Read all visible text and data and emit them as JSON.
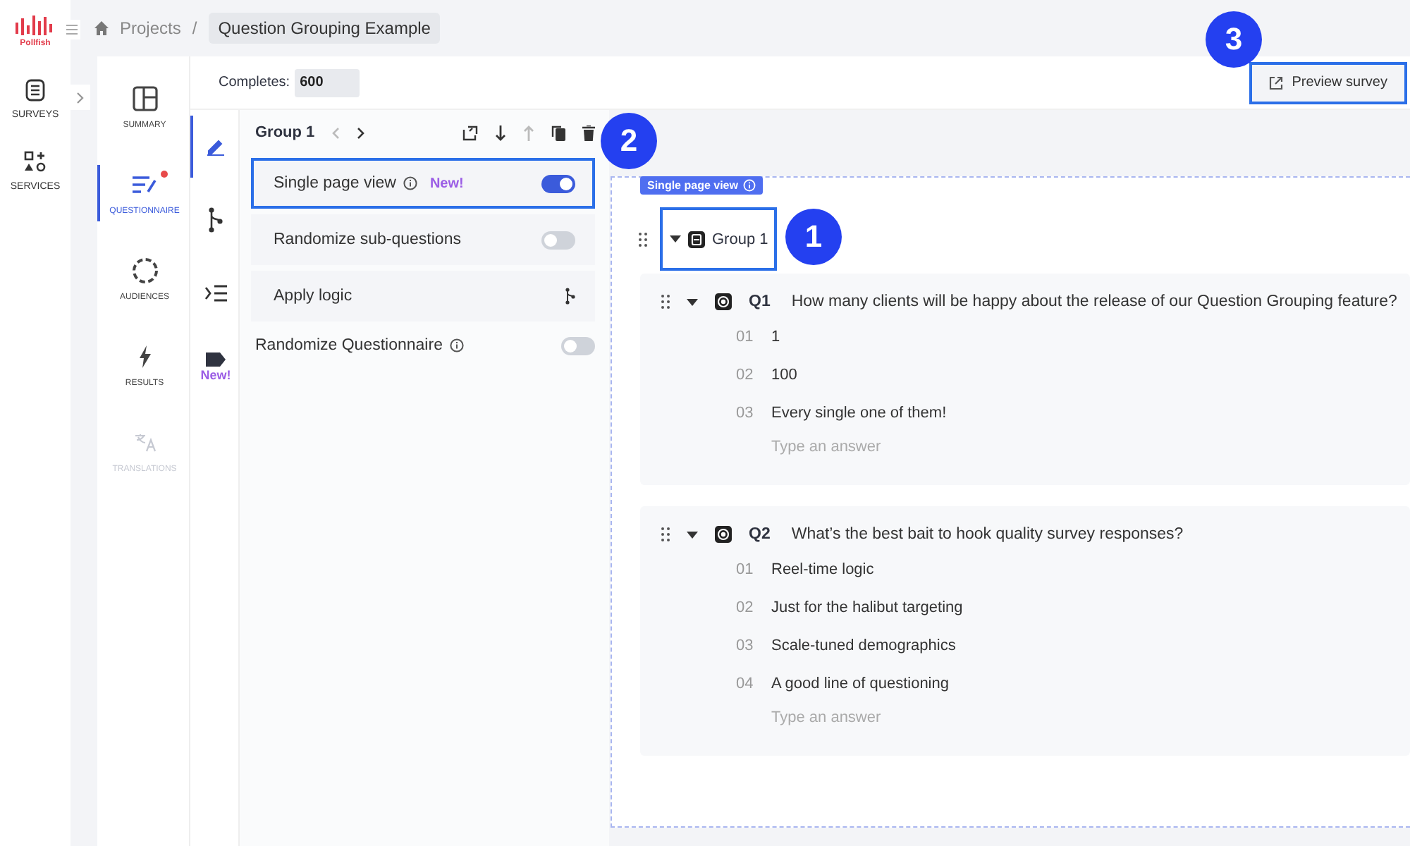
{
  "app": {
    "logo": "Pollfish"
  },
  "rail": [
    {
      "label": "SURVEYS"
    },
    {
      "label": "SERVICES"
    }
  ],
  "breadcrumb": {
    "root": "Projects",
    "separator": "/",
    "current": "Question Grouping Example"
  },
  "sections": [
    {
      "label": "SUMMARY",
      "selected": false,
      "disabled": false,
      "dot": false
    },
    {
      "label": "QUESTIONNAIRE",
      "selected": true,
      "disabled": false,
      "dot": true
    },
    {
      "label": "AUDIENCES",
      "selected": false,
      "disabled": false,
      "dot": false
    },
    {
      "label": "RESULTS",
      "selected": false,
      "disabled": false,
      "dot": false
    },
    {
      "label": "TRANSLATIONS",
      "selected": false,
      "disabled": true,
      "dot": false
    }
  ],
  "topbar": {
    "completes_label": "Completes:",
    "completes_value": "600",
    "preview_button": "Preview survey",
    "preview_highlighted": true
  },
  "tools": [
    {
      "selected": true
    },
    {
      "selected": false
    },
    {
      "selected": false
    },
    {
      "selected": false,
      "badge": "New!"
    }
  ],
  "group_panel": {
    "title": "Group 1",
    "rows": [
      {
        "kind": "toggle",
        "label": "Single page view",
        "info": true,
        "badge": "New!",
        "on": true,
        "highlighted": true
      },
      {
        "kind": "toggle",
        "label": "Randomize sub-questions",
        "info": false,
        "on": false,
        "highlighted": false
      },
      {
        "kind": "logic",
        "label": "Apply logic",
        "info": false,
        "highlighted": false
      }
    ],
    "questionnaire_setting": {
      "label": "Randomize Questionnaire",
      "info": true,
      "on": false
    }
  },
  "canvas": {
    "badge": "Single page view",
    "group_title": "Group 1",
    "group_highlighted": true,
    "questions": [
      {
        "number": "Q1",
        "text": "How many clients will be happy about the release of our Question Grouping feature?",
        "answers": [
          {
            "number": "01",
            "text": "1"
          },
          {
            "number": "02",
            "text": "100"
          },
          {
            "number": "03",
            "text": "Every single one of them!"
          }
        ],
        "placeholder": "Type an answer"
      },
      {
        "number": "Q2",
        "text": "What’s the best bait to hook quality survey responses?",
        "answers": [
          {
            "number": "01",
            "text": "Reel-time logic"
          },
          {
            "number": "02",
            "text": "Just for the halibut targeting"
          },
          {
            "number": "03",
            "text": "Scale-tuned demographics"
          },
          {
            "number": "04",
            "text": "A good line of questioning"
          }
        ],
        "placeholder": "Type an answer"
      }
    ]
  },
  "annotations": [
    {
      "label": "1"
    },
    {
      "label": "2"
    },
    {
      "label": "3"
    }
  ]
}
